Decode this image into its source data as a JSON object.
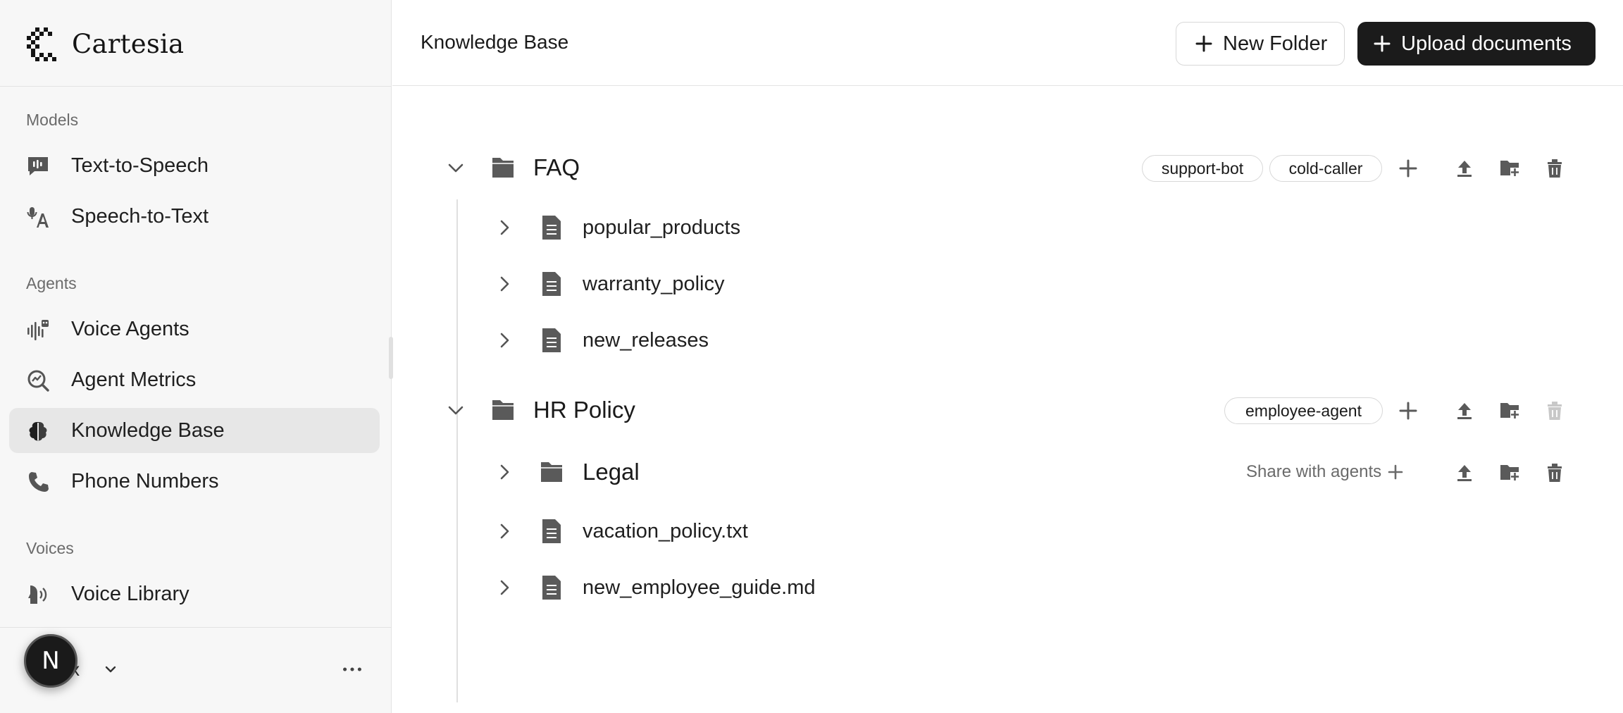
{
  "sidebar": {
    "brand": "Cartesia",
    "sections": [
      {
        "label": "Models"
      },
      {
        "label": "Agents"
      },
      {
        "label": "Voices"
      }
    ],
    "items": [
      {
        "label": "Text-to-Speech",
        "icon": "speech-bubble-waveform-icon"
      },
      {
        "label": "Speech-to-Text",
        "icon": "microphone-text-icon"
      },
      {
        "label": "Voice Agents",
        "icon": "waveform-agent-icon"
      },
      {
        "label": "Agent Metrics",
        "icon": "metrics-search-icon"
      },
      {
        "label": "Knowledge Base",
        "icon": "knowledge-base-icon",
        "active": true
      },
      {
        "label": "Phone Numbers",
        "icon": "phone-icon"
      },
      {
        "label": "Voice Library",
        "icon": "voice-library-icon"
      }
    ],
    "account": {
      "name": "x",
      "avatar_initial": "N"
    }
  },
  "header": {
    "title": "Knowledge Base",
    "new_folder_label": "New Folder",
    "upload_label": "Upload documents"
  },
  "tree": {
    "folders": [
      {
        "name": "FAQ",
        "tags": [
          "support-bot",
          "cold-caller"
        ],
        "children": [
          {
            "type": "file",
            "name": "popular_products"
          },
          {
            "type": "file",
            "name": "warranty_policy"
          },
          {
            "type": "file",
            "name": "new_releases"
          }
        ]
      },
      {
        "name": "HR Policy",
        "tags": [
          "employee-agent"
        ],
        "delete_disabled": true,
        "children": [
          {
            "type": "folder",
            "name": "Legal",
            "share_label": "Share with agents"
          },
          {
            "type": "file",
            "name": "vacation_policy.txt"
          },
          {
            "type": "file",
            "name": "new_employee_guide.md"
          }
        ]
      }
    ]
  },
  "colors": {
    "sidebar_bg": "#f7f7f7",
    "active_item_bg": "#e7e7e7",
    "primary_button_bg": "#1b1b1b",
    "icon_gray": "#5a5a5a",
    "disabled_icon": "#c4c4c4"
  }
}
